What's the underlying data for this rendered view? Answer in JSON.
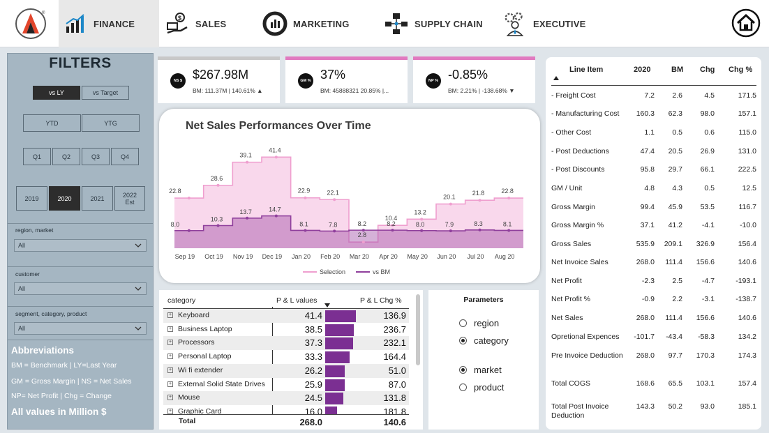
{
  "nav": {
    "items": [
      {
        "label": "FINANCE",
        "icon": "finance-chart-icon",
        "active": true
      },
      {
        "label": "SALES",
        "icon": "sales-money-icon",
        "active": false
      },
      {
        "label": "MARKETING",
        "icon": "marketing-donut-icon",
        "active": false
      },
      {
        "label": "SUPPLY CHAIN",
        "icon": "supply-chain-icon",
        "active": false
      },
      {
        "label": "EXECUTIVE",
        "icon": "executive-gears-icon",
        "active": false
      }
    ],
    "logo_mark": "®"
  },
  "filters": {
    "title": "FILTERS",
    "compare": [
      {
        "label": "vs LY",
        "on": true
      },
      {
        "label": "vs Target",
        "on": false
      }
    ],
    "period": [
      {
        "label": "YTD"
      },
      {
        "label": "YTG"
      }
    ],
    "quarters": [
      {
        "label": "Q1"
      },
      {
        "label": "Q2"
      },
      {
        "label": "Q3"
      },
      {
        "label": "Q4"
      }
    ],
    "years": [
      {
        "label": "2019",
        "on": false
      },
      {
        "label": "2020",
        "on": true
      },
      {
        "label": "2021",
        "on": false
      },
      {
        "label": "2022 Est",
        "on": false
      }
    ],
    "slicers": [
      {
        "label": "region, market",
        "value": "All"
      },
      {
        "label": "customer",
        "value": "All"
      },
      {
        "label": "segment, category, product",
        "value": "All"
      }
    ],
    "abbreviations_title": "Abbreviations",
    "abbreviations": [
      "BM = Benchmark | LY=Last Year",
      "GM = Gross Margin | NS = Net Sales",
      "NP= Net Profit | Chg = Change"
    ],
    "note": "All values in Million $"
  },
  "kpis": [
    {
      "badge": "NS $",
      "value": "$267.98M",
      "sub": "BM: 111.37M | 140.61% ▲",
      "accent": "#c8c8c8"
    },
    {
      "badge": "GM %",
      "value": "37%",
      "sub": "BM: 45888321 20.85% |...",
      "accent": "#e17ac0"
    },
    {
      "badge": "NP %",
      "value": "-0.85%",
      "sub": "BM: 2.21% | -138.68% ▼",
      "accent": "#e17ac0"
    }
  ],
  "chart_data": {
    "type": "line",
    "title": "Net Sales Performances Over Time",
    "categories": [
      "Sep 19",
      "Oct 19",
      "Nov 19",
      "Dec 19",
      "Jan 20",
      "Feb 20",
      "Mar 20",
      "Apr 20",
      "May 20",
      "Jun 20",
      "Jul 20",
      "Aug 20"
    ],
    "series": [
      {
        "name": "Selection",
        "values": [
          22.8,
          28.6,
          39.1,
          41.4,
          22.9,
          22.1,
          2.8,
          10.4,
          13.2,
          20.1,
          21.8,
          22.8
        ],
        "color": "#f4b8dc"
      },
      {
        "name": "vs BM",
        "values": [
          8.0,
          10.3,
          13.7,
          14.7,
          8.1,
          7.8,
          8.2,
          8.2,
          8.0,
          7.9,
          8.3,
          8.1
        ],
        "color": "#a251a8"
      }
    ],
    "ylim": [
      0,
      45
    ],
    "grid": false,
    "legend": "bottom-center",
    "step": true
  },
  "category_table": {
    "headers": [
      "category",
      "P & L values",
      "P & L Chg %"
    ],
    "rows": [
      {
        "name": "Keyboard",
        "value": "41.4",
        "num": 41.4,
        "chg": "136.9"
      },
      {
        "name": "Business Laptop",
        "value": "38.5",
        "num": 38.5,
        "chg": "236.7"
      },
      {
        "name": "Processors",
        "value": "37.3",
        "num": 37.3,
        "chg": "232.1"
      },
      {
        "name": "Personal Laptop",
        "value": "33.3",
        "num": 33.3,
        "chg": "164.4"
      },
      {
        "name": "Wi fi extender",
        "value": "26.2",
        "num": 26.2,
        "chg": "51.0"
      },
      {
        "name": "External Solid State Drives",
        "value": "25.9",
        "num": 25.9,
        "chg": "87.0"
      },
      {
        "name": "Mouse",
        "value": "24.5",
        "num": 24.5,
        "chg": "131.8"
      },
      {
        "name": "Graphic Card",
        "value": "16.0",
        "num": 16.0,
        "chg": "181.8"
      }
    ],
    "total": {
      "label": "Total",
      "value": "268.0",
      "chg": "140.6"
    },
    "bar_color": "#7b2f92"
  },
  "parameters": {
    "title": "Parameters",
    "group1": [
      {
        "label": "region",
        "on": false
      },
      {
        "label": "category",
        "on": true
      }
    ],
    "group2": [
      {
        "label": "market",
        "on": true
      },
      {
        "label": "product",
        "on": false
      }
    ]
  },
  "pl_table": {
    "headers": [
      "Line Item",
      "2020",
      "BM",
      "Chg",
      "Chg %"
    ],
    "rows": [
      {
        "name": "- Freight Cost",
        "v": "7.2",
        "bm": "2.6",
        "chg": "4.5",
        "pct": "171.5"
      },
      {
        "name": "- Manufacturing Cost",
        "v": "160.3",
        "bm": "62.3",
        "chg": "98.0",
        "pct": "157.1"
      },
      {
        "name": "- Other Cost",
        "v": "1.1",
        "bm": "0.5",
        "chg": "0.6",
        "pct": "115.0"
      },
      {
        "name": "- Post Deductions",
        "v": "47.4",
        "bm": "20.5",
        "chg": "26.9",
        "pct": "131.0"
      },
      {
        "name": "- Post Discounts",
        "v": "95.8",
        "bm": "29.7",
        "chg": "66.1",
        "pct": "222.5"
      },
      {
        "name": "GM / Unit",
        "v": "4.8",
        "bm": "4.3",
        "chg": "0.5",
        "pct": "12.5"
      },
      {
        "name": "Gross Margin",
        "v": "99.4",
        "bm": "45.9",
        "chg": "53.5",
        "pct": "116.7"
      },
      {
        "name": "Gross Margin %",
        "v": "37.1",
        "bm": "41.2",
        "chg": "-4.1",
        "pct": "-10.0"
      },
      {
        "name": "Gross Sales",
        "v": "535.9",
        "bm": "209.1",
        "chg": "326.9",
        "pct": "156.4"
      },
      {
        "name": "Net Invoice Sales",
        "v": "268.0",
        "bm": "111.4",
        "chg": "156.6",
        "pct": "140.6"
      },
      {
        "name": "Net Profit",
        "v": "-2.3",
        "bm": "2.5",
        "chg": "-4.7",
        "pct": "-193.1"
      },
      {
        "name": "Net Profit %",
        "v": "-0.9",
        "bm": "2.2",
        "chg": "-3.1",
        "pct": "-138.7"
      },
      {
        "name": "Net Sales",
        "v": "268.0",
        "bm": "111.4",
        "chg": "156.6",
        "pct": "140.6"
      },
      {
        "name": "Opretional Expences",
        "v": "-101.7",
        "bm": "-43.4",
        "chg": "-58.3",
        "pct": "134.2"
      },
      {
        "name": "Pre Invoice Deduction",
        "v": "268.0",
        "bm": "97.7",
        "chg": "170.3",
        "pct": "174.3"
      },
      {
        "name": "Total COGS",
        "v": "168.6",
        "bm": "65.5",
        "chg": "103.1",
        "pct": "157.4"
      },
      {
        "name": "Total Post Invoice Deduction",
        "v": "143.3",
        "bm": "50.2",
        "chg": "93.0",
        "pct": "185.1"
      }
    ]
  }
}
